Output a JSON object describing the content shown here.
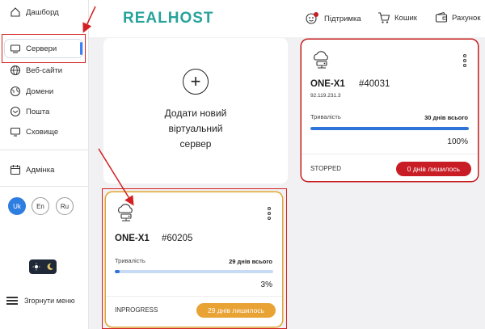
{
  "brand": {
    "logo": "REALHOST",
    "accent": "#27a39a"
  },
  "sidebar": {
    "items": [
      {
        "label": "Дашборд",
        "icon": "home-icon"
      },
      {
        "label": "Сервери",
        "icon": "server-icon",
        "active": true
      },
      {
        "label": "Веб-сайти",
        "icon": "globe-icon"
      },
      {
        "label": "Домени",
        "icon": "globe-icon"
      },
      {
        "label": "Пошта",
        "icon": "mail-icon"
      },
      {
        "label": "Сховище",
        "icon": "monitor-icon"
      }
    ],
    "admin": {
      "label": "Адмінка",
      "icon": "calendar-icon"
    },
    "languages": [
      "Uk",
      "En",
      "Ru"
    ],
    "active_language": "Uk",
    "collapse_label": "Згорнути меню"
  },
  "header": {
    "support_label": "Підтримка",
    "cart_label": "Кошик",
    "account_label": "Рахунок"
  },
  "add_card": {
    "line1": "Додати новий",
    "line2": "віртуальний",
    "line3": "сервер"
  },
  "servers": [
    {
      "name": "ONE-X1",
      "id": "#40031",
      "ip": "92.119.231.3",
      "duration_label": "Тривалість",
      "duration_total": "30 днів всього",
      "progress": 100,
      "progress_text": "100%",
      "status": "STOPPED",
      "remaining": "0 днів лишилось",
      "status_color": "#c81d25"
    },
    {
      "name": "ONE-X1",
      "id": "#60205",
      "duration_label": "Тривалість",
      "duration_total": "29 днів всього",
      "progress": 3,
      "progress_text": "3%",
      "status": "INPROGRESS",
      "remaining": "29 днів лишилось",
      "status_color": "#e9a234"
    }
  ]
}
